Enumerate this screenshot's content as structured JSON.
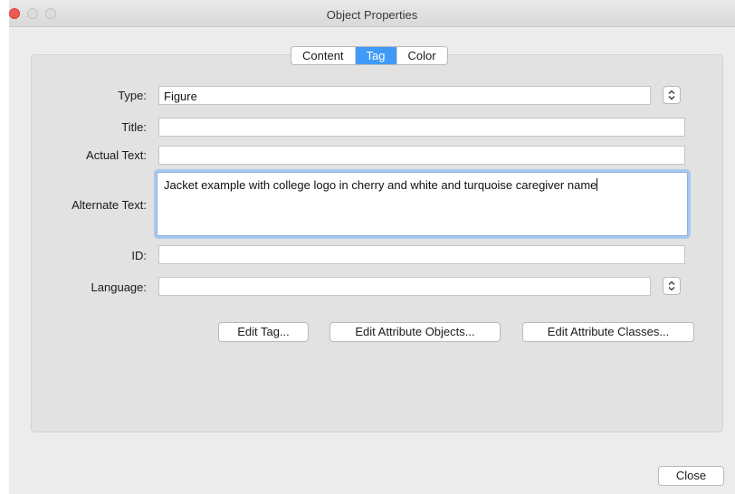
{
  "window": {
    "title": "Object Properties"
  },
  "tabs": [
    {
      "label": "Content",
      "active": false
    },
    {
      "label": "Tag",
      "active": true
    },
    {
      "label": "Color",
      "active": false
    }
  ],
  "form": {
    "type": {
      "label": "Type:",
      "value": "Figure"
    },
    "title": {
      "label": "Title:",
      "value": ""
    },
    "actual_text": {
      "label": "Actual Text:",
      "value": ""
    },
    "alternate_text": {
      "label": "Alternate Text:",
      "value": "Jacket example with college logo in cherry and white and turquoise caregiver name"
    },
    "id": {
      "label": "ID:",
      "value": ""
    },
    "language": {
      "label": "Language:",
      "value": ""
    }
  },
  "buttons": {
    "edit_tag": "Edit Tag...",
    "edit_attribute_objects": "Edit Attribute Objects...",
    "edit_attribute_classes": "Edit Attribute Classes...",
    "close": "Close"
  },
  "colors": {
    "accent": "#3f9bf6",
    "close_traffic": "#ee5a52",
    "focus_ring": "#a9c8f0"
  }
}
